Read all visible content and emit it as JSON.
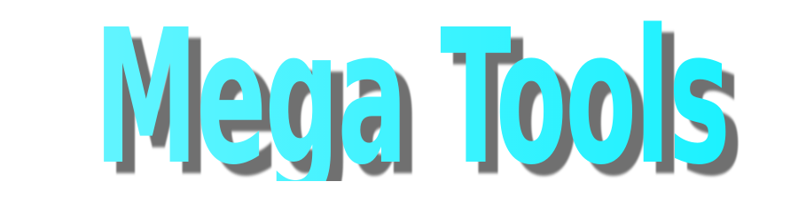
{
  "logo": {
    "text": "Mega Tools",
    "colors": {
      "fill_left": "#62f4ff",
      "fill_right": "#1cf2ff",
      "shadow": "#6f6f6f",
      "background": "#ffffff"
    }
  }
}
